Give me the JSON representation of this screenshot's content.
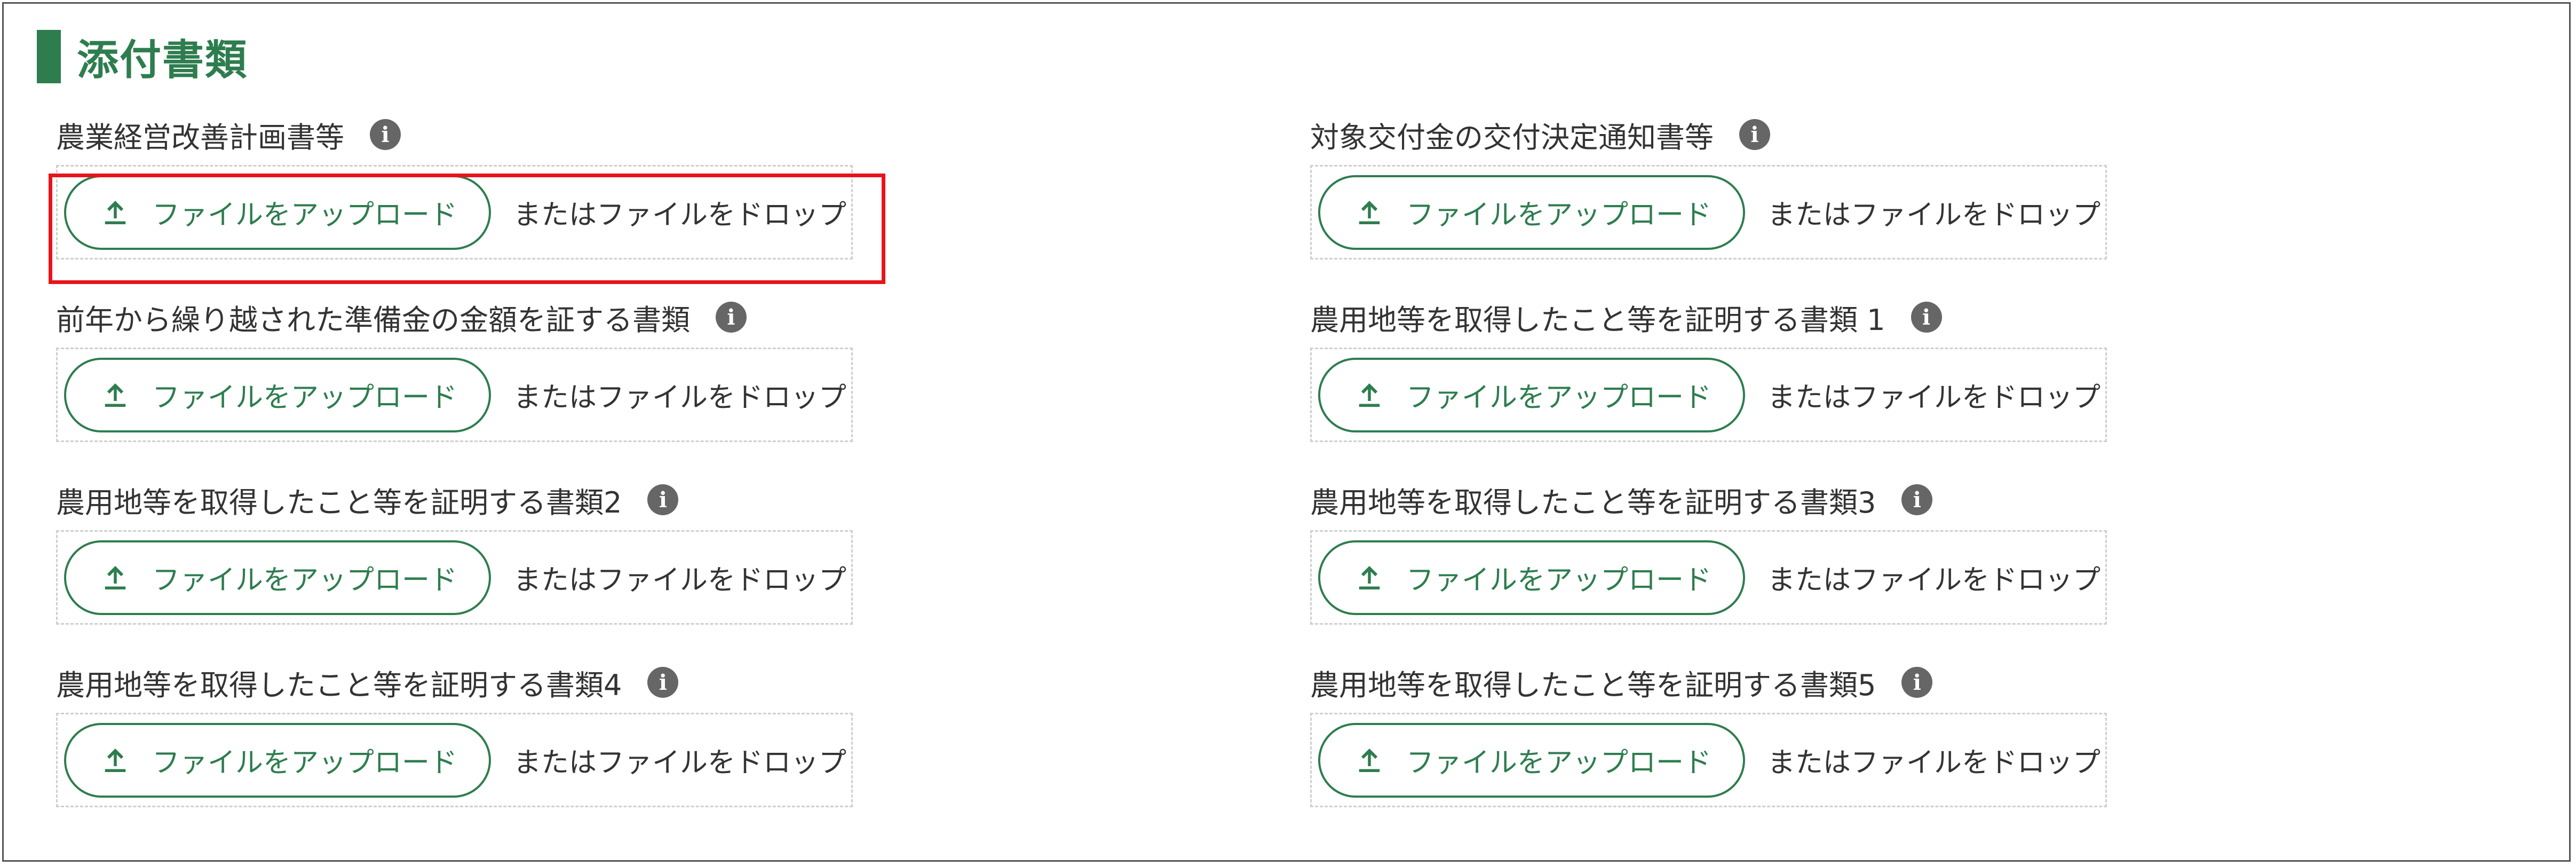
{
  "section": {
    "title": "添付書類"
  },
  "common": {
    "upload_button_label": "ファイルをアップロード",
    "drop_text": "またはファイルをドロップ",
    "info_glyph": "i"
  },
  "colors": {
    "accent": "#2e7d4f",
    "highlight": "#e8141b",
    "info_icon": "#666666"
  },
  "fields": [
    {
      "label": "農業経営改善計画書等"
    },
    {
      "label": "対象交付金の交付決定通知書等"
    },
    {
      "label": "前年から繰り越された準備金の金額を証する書類"
    },
    {
      "label": "農用地等を取得したこと等を証明する書類 1"
    },
    {
      "label": "農用地等を取得したこと等を証明する書類2"
    },
    {
      "label": "農用地等を取得したこと等を証明する書類3"
    },
    {
      "label": "農用地等を取得したこと等を証明する書類4"
    },
    {
      "label": "農用地等を取得したこと等を証明する書類5"
    }
  ]
}
